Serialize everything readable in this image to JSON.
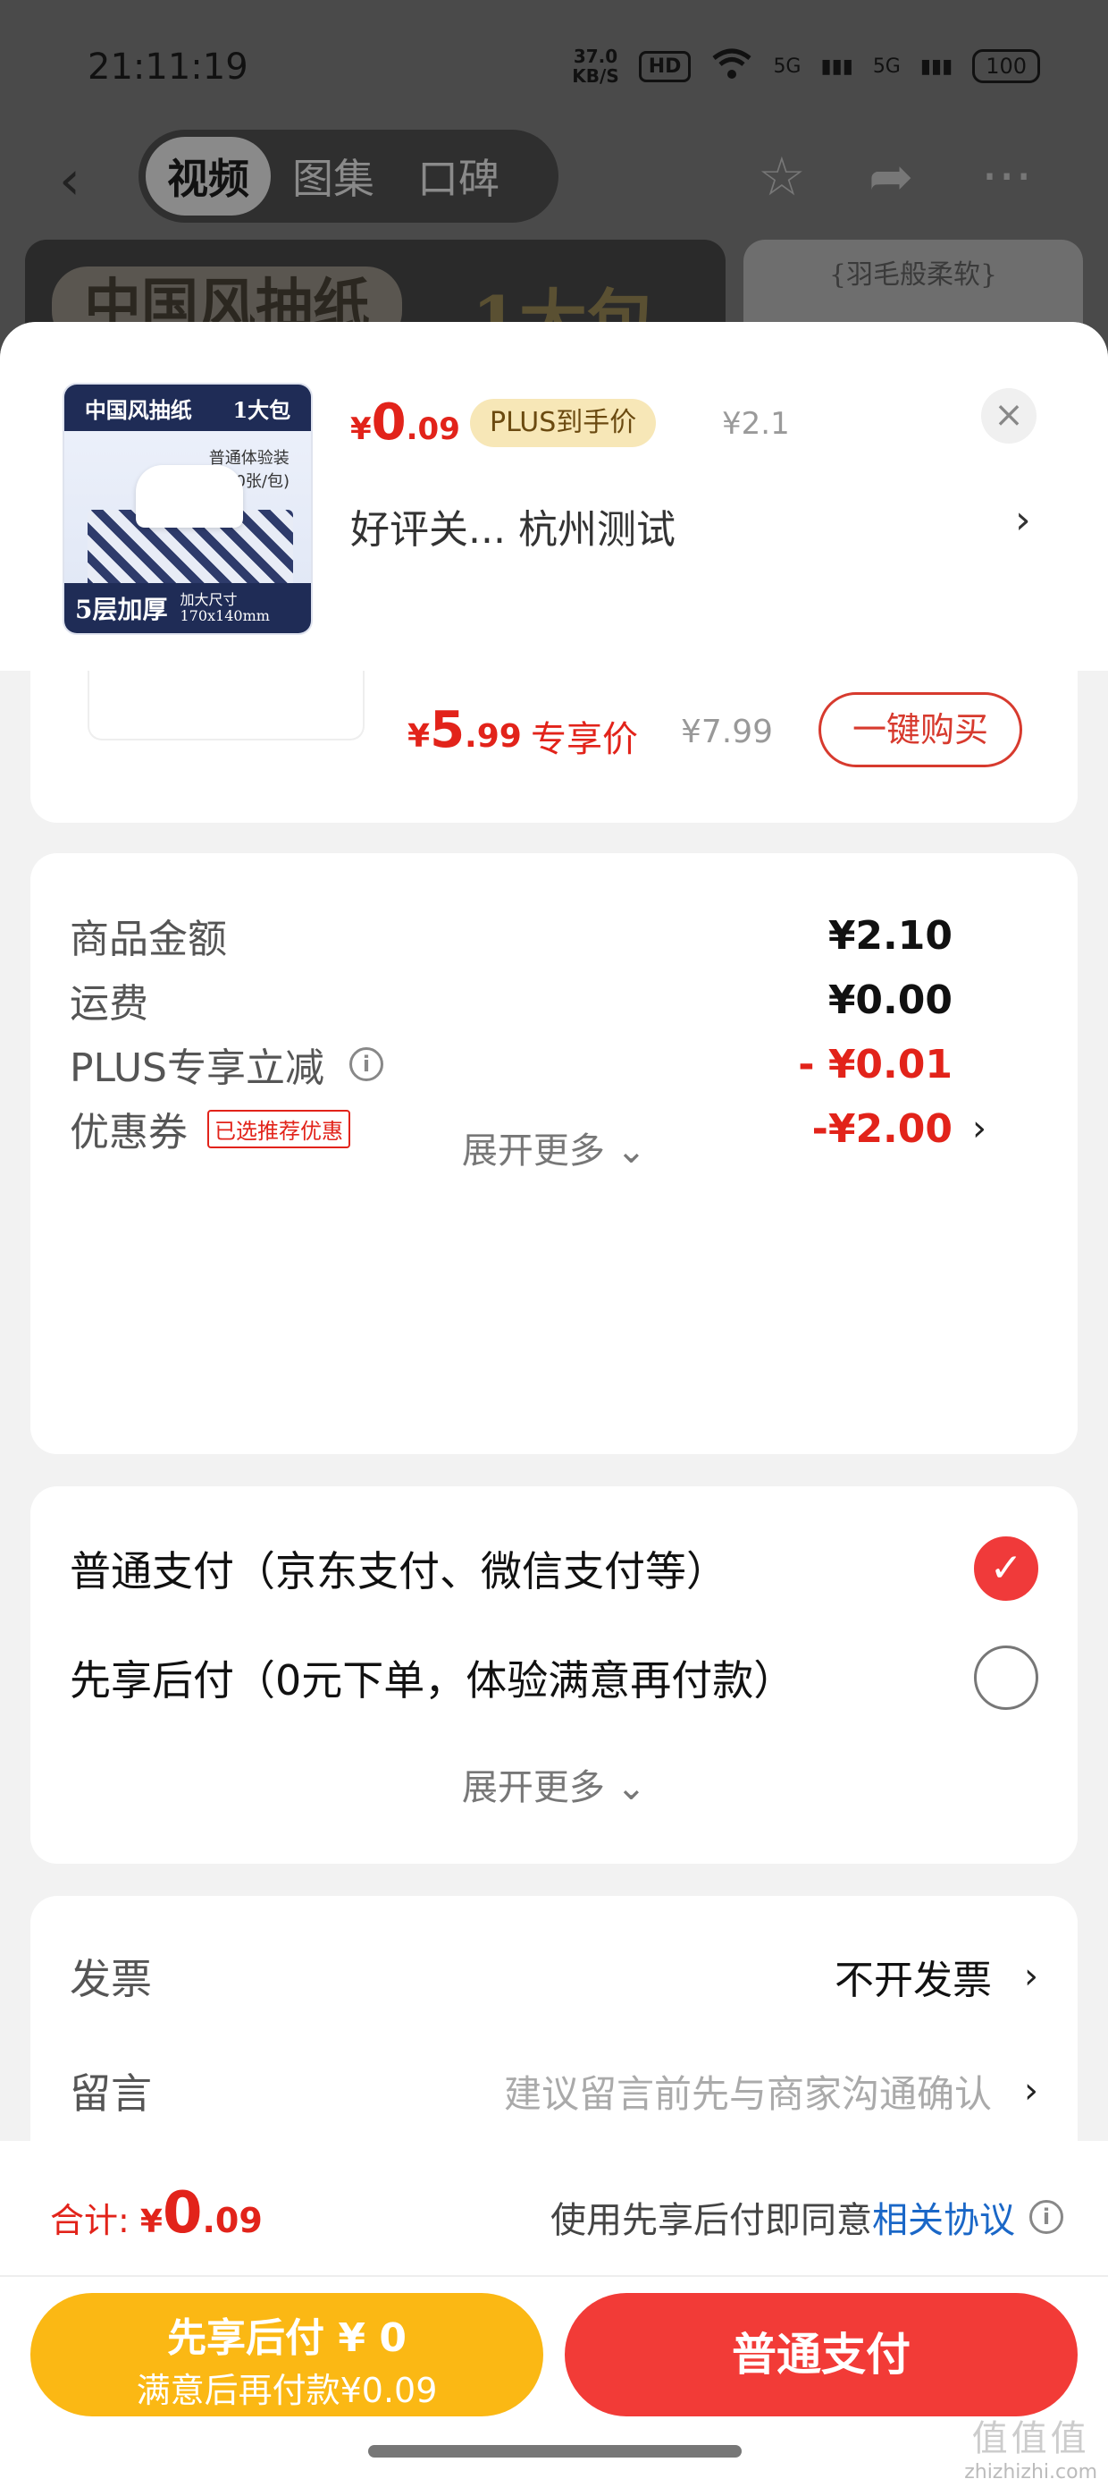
{
  "status": {
    "time": "21:11:19",
    "netspeed_value": "37.0",
    "netspeed_unit": "KB/S",
    "hd": "HD",
    "signal1": "5G",
    "signal2": "5G",
    "battery": "100"
  },
  "nav": {
    "tabs": [
      "视频",
      "图集",
      "口碑"
    ],
    "active_tab": "视频"
  },
  "banner": {
    "left_text": "中国风抽纸",
    "left_text2": "1大包",
    "right_text": "{羽毛般柔软}"
  },
  "product": {
    "image": {
      "brand": "中国风抽纸",
      "pack": "1大包",
      "sub1": "普通体验装",
      "sub2": "(280张/包)",
      "layers": "5层加厚",
      "size1": "加大尺寸",
      "size2": "170x140mm"
    },
    "price_currency": "¥",
    "price_int": "0",
    "price_dec": ".09",
    "plus_tag": "PLUS到手价",
    "original_price": "¥2.1",
    "store_line": "好评关...  杭州测试"
  },
  "deal": {
    "price_currency": "¥",
    "price_int": "5",
    "price_dec": ".99",
    "label": "专享价",
    "orig": "¥7.99",
    "button": "一键购买"
  },
  "summary": {
    "rows": [
      {
        "label": "商品金额",
        "value": "¥2.10"
      },
      {
        "label": "运费",
        "value": "¥0.00"
      },
      {
        "label": "PLUS专享立减",
        "value": "- ¥0.01"
      },
      {
        "label": "优惠券",
        "tag": "已选推荐优惠",
        "value": "-¥2.00"
      }
    ],
    "expand": "展开更多"
  },
  "payment": {
    "options": [
      {
        "label": "普通支付（京东支付、微信支付等）",
        "checked": true
      },
      {
        "label": "先享后付（0元下单，体验满意再付款）",
        "checked": false
      }
    ],
    "expand": "展开更多"
  },
  "extra": {
    "invoice_label": "发票",
    "invoice_value": "不开发票",
    "note_label": "留言",
    "note_placeholder": "建议留言前先与商家沟通确认"
  },
  "footer": {
    "total_label": "合计: ",
    "total_currency": "¥",
    "total_int": "0",
    "total_dec": ".09",
    "agree_text": "使用先享后付即同意",
    "agree_link": "相关协议",
    "later_line1": "先享后付 ¥ 0",
    "later_line2": "满意后再付款¥0.09",
    "normal_button": "普通支付",
    "watermark": "zhizhizhi.com"
  },
  "colors": {
    "accent_red": "#e2231a",
    "button_red": "#f23b37",
    "button_yellow": "#fbb814",
    "link_blue": "#1a67c7"
  }
}
